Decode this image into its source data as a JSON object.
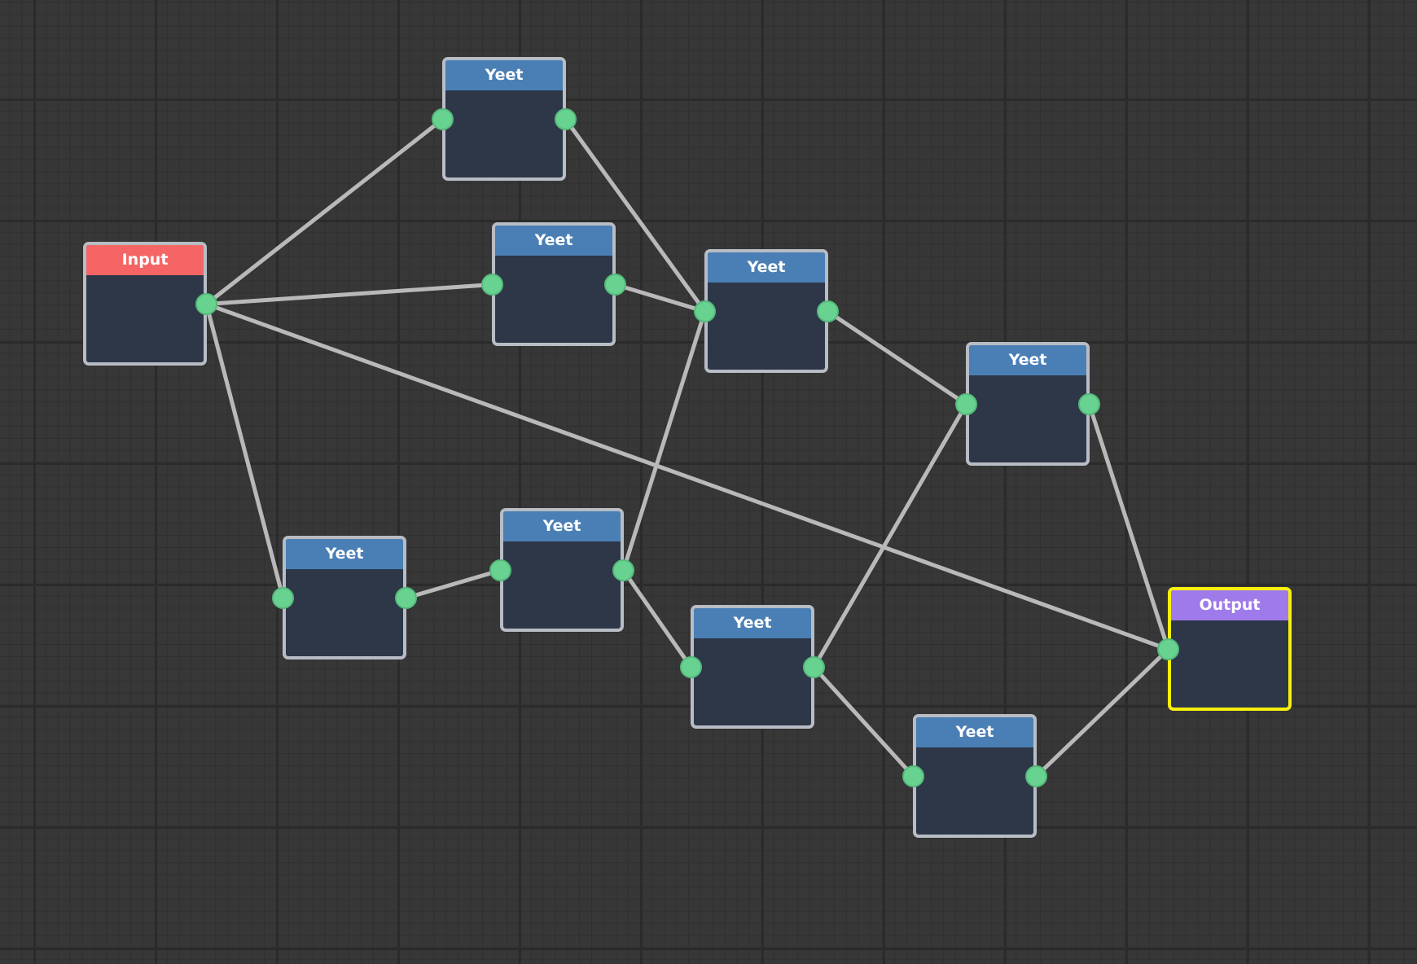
{
  "editor": {
    "colors": {
      "background": "#373737",
      "grid_major": "#2b2b2b",
      "grid_minor": "#303030",
      "node_body": "#2d3748",
      "node_border": "#b8bcc4",
      "selected_border": "#f7f00c",
      "port": "#68d391",
      "edge": "#b9b9b9",
      "input_header": "#f56565",
      "yeet_header": "#4a7fb5",
      "output_header": "#9f7aea"
    },
    "nodes": [
      {
        "id": "input",
        "title": "Input",
        "kind": "input",
        "ports": [
          "out"
        ]
      },
      {
        "id": "yeet-1",
        "title": "Yeet",
        "kind": "yeet",
        "ports": [
          "in",
          "out"
        ]
      },
      {
        "id": "yeet-2",
        "title": "Yeet",
        "kind": "yeet",
        "ports": [
          "in",
          "out"
        ]
      },
      {
        "id": "yeet-3",
        "title": "Yeet",
        "kind": "yeet",
        "ports": [
          "in",
          "out"
        ]
      },
      {
        "id": "yeet-4",
        "title": "Yeet",
        "kind": "yeet",
        "ports": [
          "in",
          "out"
        ]
      },
      {
        "id": "yeet-5",
        "title": "Yeet",
        "kind": "yeet",
        "ports": [
          "in",
          "out"
        ]
      },
      {
        "id": "yeet-6",
        "title": "Yeet",
        "kind": "yeet",
        "ports": [
          "in",
          "out"
        ]
      },
      {
        "id": "yeet-7",
        "title": "Yeet",
        "kind": "yeet",
        "ports": [
          "in",
          "out"
        ]
      },
      {
        "id": "yeet-8",
        "title": "Yeet",
        "kind": "yeet",
        "ports": [
          "in",
          "out"
        ]
      },
      {
        "id": "output",
        "title": "Output",
        "kind": "output",
        "ports": [
          "in"
        ],
        "selected": true
      }
    ],
    "edges": [
      {
        "from": "input",
        "to": "yeet-1"
      },
      {
        "from": "input",
        "to": "yeet-2"
      },
      {
        "from": "input",
        "to": "yeet-5"
      },
      {
        "from": "input",
        "to": "output"
      },
      {
        "from": "yeet-1",
        "to": "yeet-3"
      },
      {
        "from": "yeet-2",
        "to": "yeet-3"
      },
      {
        "from": "yeet-3",
        "to": "yeet-4"
      },
      {
        "from": "yeet-5",
        "to": "yeet-6"
      },
      {
        "from": "yeet-6",
        "to": "yeet-3"
      },
      {
        "from": "yeet-6",
        "to": "yeet-7"
      },
      {
        "from": "yeet-7",
        "to": "yeet-4"
      },
      {
        "from": "yeet-7",
        "to": "yeet-8"
      },
      {
        "from": "yeet-4",
        "to": "output"
      },
      {
        "from": "yeet-8",
        "to": "output"
      }
    ]
  }
}
